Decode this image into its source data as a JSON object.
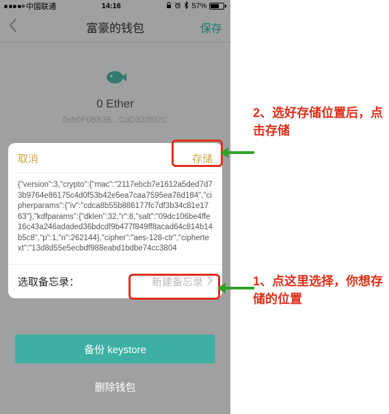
{
  "status": {
    "carrier": "中国联通",
    "time": "14:16",
    "battery_pct": "57%"
  },
  "nav": {
    "title": "富豪的钱包",
    "save": "保存"
  },
  "wallet": {
    "balance": "0 Ether",
    "address": "0xb0F0BB35...CdD333f02C"
  },
  "sheet": {
    "cancel": "取消",
    "store": "存储",
    "json_text": "{\"version\":3,\"crypto\":{\"mac\":\"2117ebcb7e1612a5ded7d73b9764e86175c4d0f53b42e5ea7caa7595ea76d184\",\"cipherparams\":{\"iv\":\"cdca8b55b886177fc7df3b34c81e1763\"},\"kdfparams\":{\"dklen\":32,\"r\":8,\"salt\":\"09dc106be4ffe16c43a246adaded36bdcdf9b477f849ff8acad64c814b14b5c8\",\"p\":1,\"n\":262144},\"cipher\":\"aes-128-ctr\",\"ciphertext\":\"13d8d55e5ecbdf988eabd1bdbe74cc3804",
    "memo_label": "选取备忘录：",
    "memo_value": "新建备忘录"
  },
  "buttons": {
    "backup": "备份 keystore",
    "delete": "删除钱包"
  },
  "annotations": {
    "a1": "1、点这里选择，你想存储的位置",
    "a2": "2、选好存储位置后，点击存储"
  }
}
